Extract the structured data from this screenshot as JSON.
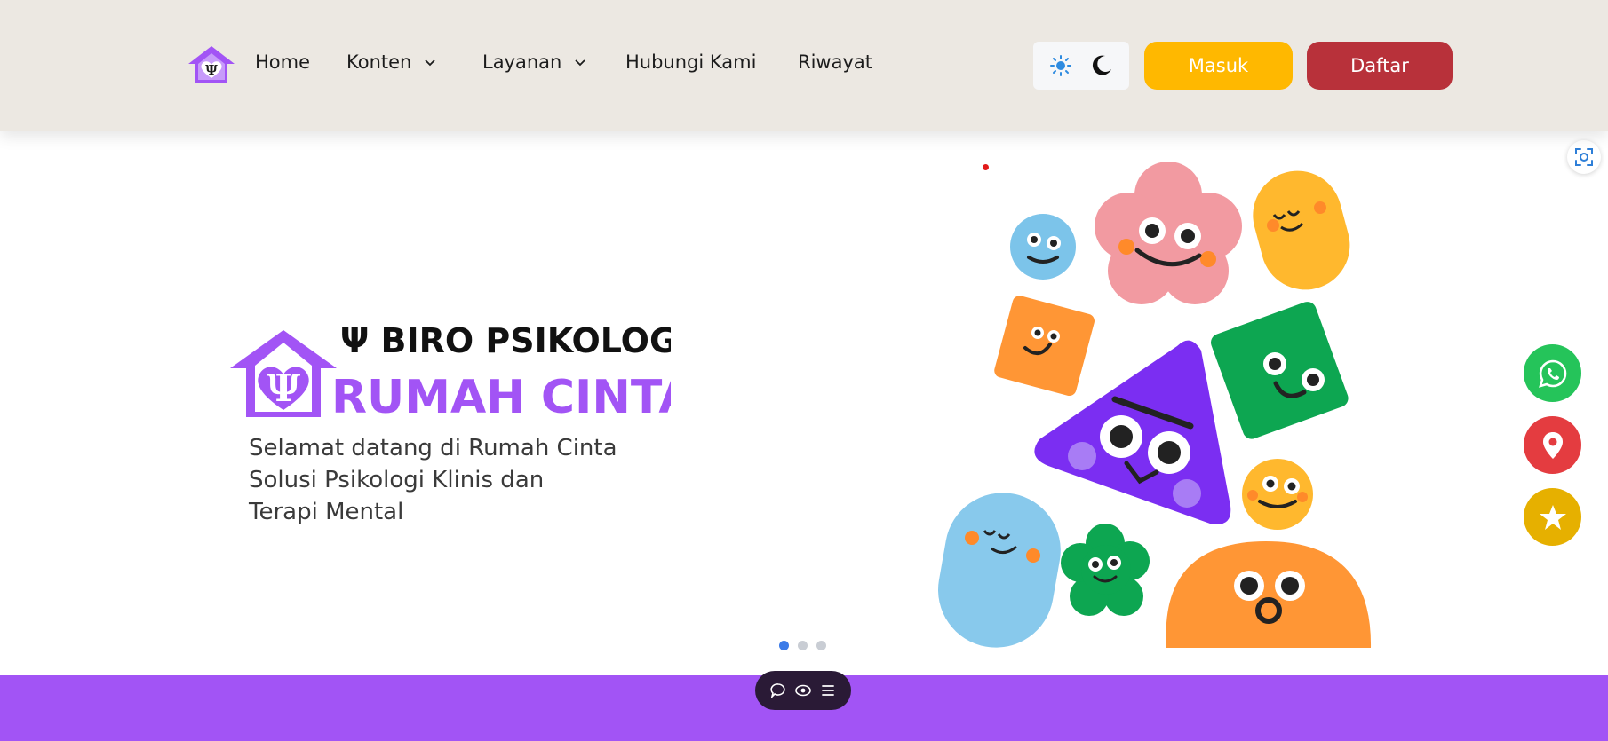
{
  "nav": {
    "brand_icon": "psi-house-logo-icon",
    "items": [
      {
        "label": "Home"
      },
      {
        "label": "Konten",
        "has_dropdown": true
      },
      {
        "label": "Layanan",
        "has_dropdown": true
      },
      {
        "label": "Hubungi Kami"
      },
      {
        "label": "Riwayat"
      }
    ],
    "theme_icons": [
      "sun-icon",
      "moon-icon"
    ],
    "login_label": "Masuk",
    "register_label": "Daftar"
  },
  "hero": {
    "logo_line1": "Ψ BIRO PSIKOLOGI",
    "logo_line2": "RUMAH CINTA",
    "tagline": [
      "Selamat datang di Rumah Cinta",
      "Solusi Psikologi Klinis dan",
      "Terapi Mental"
    ],
    "slide_count": 3,
    "active_slide": 1
  },
  "floating_actions": [
    "whatsapp-icon",
    "location-pin-icon",
    "star-icon"
  ],
  "toolbar_icons": [
    "chat-icon",
    "eye-icon",
    "menu-icon"
  ],
  "colors": {
    "navbar_bg": "#ECE8E2",
    "brand_purple": "#A254F5",
    "login_yellow": "#FFB800",
    "register_red": "#B8313A",
    "whatsapp_green": "#25C45A",
    "location_red": "#E43C40",
    "star_gold": "#E6B000",
    "active_dot": "#3B7BE8"
  }
}
